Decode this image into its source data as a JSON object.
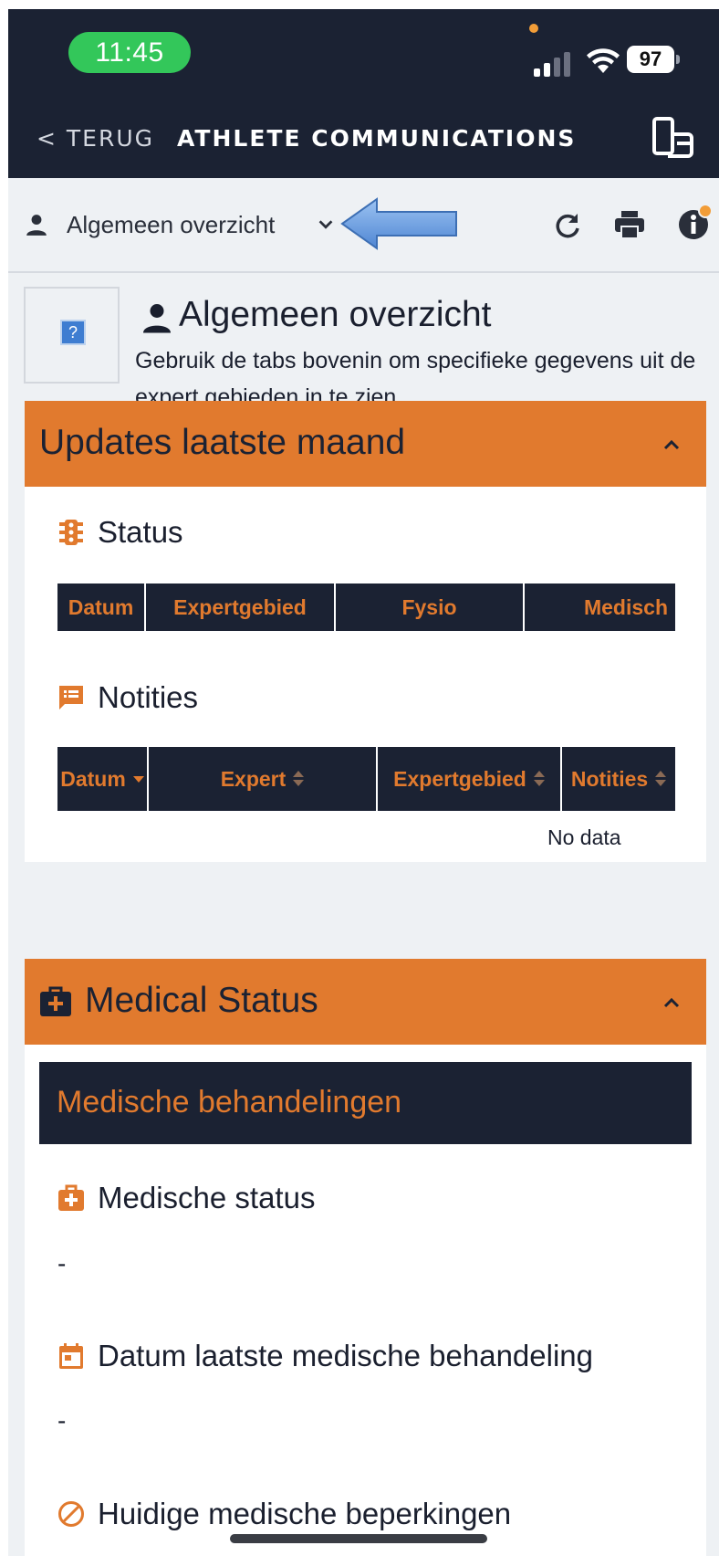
{
  "status_bar": {
    "time": "11:45",
    "battery": "97",
    "icons": [
      "cellular-signal-icon",
      "wifi-icon",
      "battery-icon"
    ]
  },
  "header": {
    "back_label": "< TERUG",
    "title": "ATHLETE COMMUNICATIONS",
    "action_icon": "switch-device-icon"
  },
  "toolbar": {
    "view_label": "Algemeen overzicht",
    "icons": [
      "person-icon",
      "chevron-down-icon",
      "refresh-icon",
      "print-icon",
      "info-icon"
    ]
  },
  "intro": {
    "title": "Algemeen overzicht",
    "subtitle": "Gebruik de tabs bovenin om specifieke gegevens uit de expert gebieden in te zien",
    "image_placeholder": "?"
  },
  "updates_card": {
    "title": "Updates laatste maand",
    "status_section": {
      "title": "Status",
      "columns": [
        "Datum",
        "Expertgebied",
        "Fysio",
        "Medisch"
      ]
    },
    "notes_section": {
      "title": "Notities",
      "columns": [
        "Datum",
        "Expert",
        "Expertgebied",
        "Notities"
      ],
      "empty_text": "No data"
    }
  },
  "medical_card": {
    "title": "Medical Status",
    "banner": "Medische behandelingen",
    "fields": [
      {
        "label": "Medische status",
        "value": "-"
      },
      {
        "label": "Datum laatste medische behandeling",
        "value": "-"
      },
      {
        "label": "Huidige medische beperkingen",
        "value": ""
      }
    ]
  },
  "colors": {
    "navy": "#1b2233",
    "orange": "#e17a2e",
    "background": "#eef1f4",
    "arrow_blue": "#6a9fe0",
    "status_green": "#33c75a"
  }
}
